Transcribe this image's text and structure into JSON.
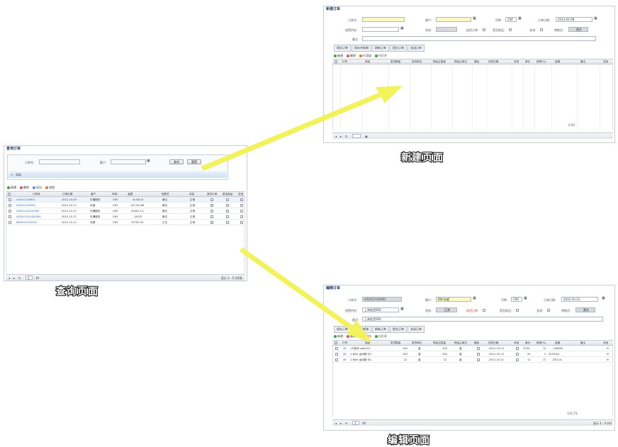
{
  "colors": {
    "arrow": "#f2f25a",
    "accent": "#1f3a60",
    "field_yellow": "#fdf8c6"
  },
  "captions": {
    "query": "查询页面",
    "new": "新建页面",
    "edit": "编辑页面"
  },
  "query_page": {
    "title": "查询订单",
    "order_no_label": "订单号:",
    "customer_label": "客户:",
    "search_button": "查询",
    "reset_button": "重置",
    "advanced_label": "高级",
    "toolbar": [
      "新建",
      "删除",
      "导出",
      "流程"
    ],
    "columns": [
      "订单号",
      "订单日期",
      "客户",
      "币种",
      "金额",
      "销售员",
      "状态",
      "退货订单",
      "是否商品",
      "关闭"
    ],
    "rows": [
      {
        "order_no": "xs2012100901",
        "date": "2012-10-09",
        "customer": "宇通服务",
        "currency": "CNY",
        "amount": "41344.8",
        "sales": "黄文",
        "status": "正常"
      },
      {
        "order_no": "XS2012100001",
        "date": "2012-10-12",
        "customer": "巩威",
        "currency": "CNY",
        "amount": "141744.86",
        "sales": "黄文",
        "status": "正常"
      },
      {
        "order_no": "XS20121010L3AP",
        "date": "2012-10-12",
        "customer": "宇通服务",
        "currency": "CNY",
        "amount": "33451.14",
        "sales": "黄文",
        "status": "正常"
      },
      {
        "order_no": "XS20121010DL0B1",
        "date": "2012-10-12",
        "customer": "宇通服务",
        "currency": "CNY",
        "amount": "24070",
        "sales": "黄文",
        "status": "正常"
      },
      {
        "order_no": "WH2012101201",
        "date": "2012-10-12",
        "customer": "巩威",
        "currency": "CNY",
        "amount": "19702.93",
        "sales": "王文",
        "status": "正常"
      }
    ],
    "pager": {
      "page": "1",
      "page_size": "10",
      "summary": "显示 1 - 5 共5条"
    }
  },
  "new_page": {
    "title": "新建订单",
    "order_no_label": "订单号:",
    "customer_label": "客户:",
    "currency_label": "币种:",
    "currency_value": "CNY",
    "order_date_label": "订单日期:",
    "order_date_value": "2013-01-08",
    "purchaser_label": "接受供应:",
    "status_label": "状态:",
    "return_label": "退货订单:",
    "goods_label": "是否商品:",
    "close_label": "关闭:",
    "sales_label": "销售员:",
    "sales_value": "黄文",
    "remark_label": "备注:",
    "tabs": [
      "保存订单",
      "保存并新增",
      "刷新订单",
      "提交订单",
      "关闭订单"
    ],
    "toolbar": [
      "新增",
      "删除",
      "行添加",
      "行打开"
    ],
    "columns": [
      "行号",
      "商品",
      "发货数量",
      "发货单位",
      "物品主数量",
      "物品主单位",
      "赠品",
      "到货日期",
      "关闭",
      "单价",
      "税率(%)",
      "金额",
      "备注",
      "关闭"
    ],
    "total": "0.00"
  },
  "edit_page": {
    "title": "编辑订单",
    "order_no_label": "订单号:",
    "order_no_value": "XS2012100001",
    "customer_label": "客户:",
    "customer_value": "BW-巩威",
    "currency_label": "币种:",
    "currency_value": "CNY",
    "order_date_label": "订单日期:",
    "order_date_value": "2012-10-12",
    "purchaser_label": "接受供应:",
    "purchaser_value": "上海发货000",
    "status_label": "状态:",
    "status_value": "正常",
    "return_label": "退货订单:",
    "goods_label": "是否商品:",
    "close_label": "关闭:",
    "sales_label": "销售员:",
    "sales_value": "黄文",
    "remark_label": "备注:",
    "remark_value": "上海发货000",
    "tabs": [
      "保存订单",
      "保存并新增",
      "刷新订单",
      "提交订单",
      "关闭订单"
    ],
    "toolbar": [
      "新增",
      "删除",
      "行添加",
      "行打开"
    ],
    "columns": [
      "行号",
      "商品",
      "发货数量",
      "发货单位",
      "物品主数量",
      "物品主单位",
      "赠品",
      "到货日期",
      "关闭",
      "单价",
      "税率(%)",
      "金额",
      "备注",
      "关闭"
    ],
    "rows": [
      {
        "line": "10",
        "item": "1平板车 wsb110",
        "qty": "100",
        "unit": "盒",
        "main_qty": "100",
        "main_unit": "盒",
        "date": "2012-10-13",
        "price": "1234",
        "tax": "12",
        "amount": "138208",
        "close": "N"
      },
      {
        "line": "20",
        "item": "1-Nike 运动鞋 NT...",
        "qty": "150",
        "unit": "盒",
        "main_qty": "150",
        "main_unit": "盒",
        "date": "2012-10-13",
        "price": "24",
        "tax": "2",
        "amount": "3233.84",
        "close": "N"
      },
      {
        "line": "30",
        "item": "1-Nike 运动鞋 NT...",
        "qty": "22",
        "unit": "盒",
        "main_qty": "22",
        "main_unit": "盒",
        "date": "2012-10-1s",
        "price": "11",
        "tax": "17",
        "amount": "283.14",
        "close": "N"
      }
    ],
    "total": "141,74...",
    "pager": {
      "page": "1",
      "page_size": "10",
      "summary": "显示 1 - 3 共3"
    }
  }
}
